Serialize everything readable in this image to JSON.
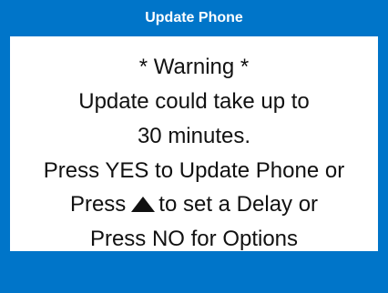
{
  "title": "Update Phone",
  "message": {
    "line1": "* Warning *",
    "line2": "Update could take up to",
    "line3": "30 minutes.",
    "line4": "Press YES to Update Phone or",
    "line5_before": "Press",
    "line5_after": "to set a Delay or",
    "line6": "Press NO for Options"
  },
  "icons": {
    "arrow": "up-triangle-icon"
  },
  "colors": {
    "frame": "#0075c9",
    "content_bg": "#ffffff",
    "text": "#111111"
  }
}
